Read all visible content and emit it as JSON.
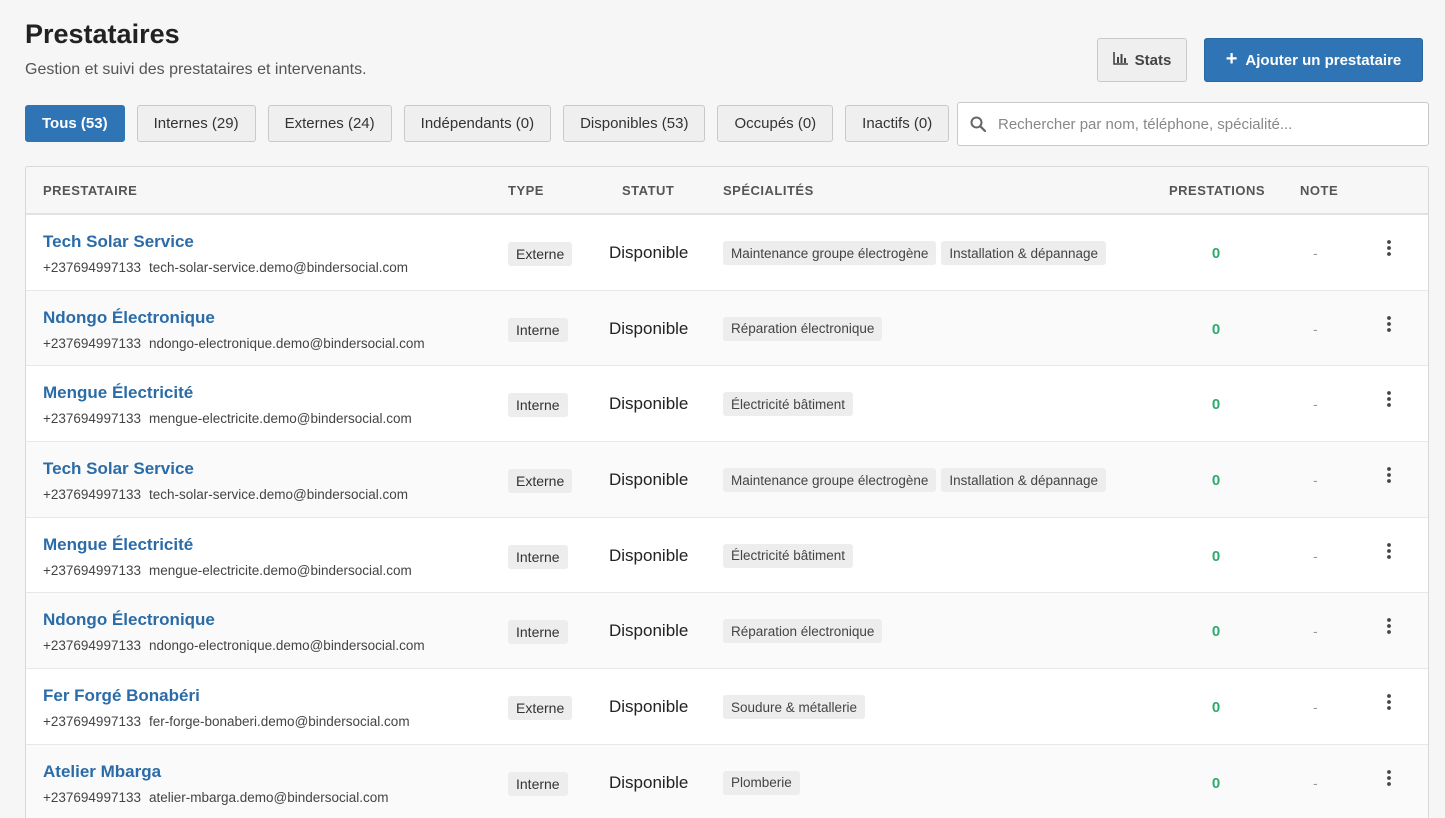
{
  "header": {
    "title": "Prestataires",
    "subtitle": "Gestion et suivi des prestataires et intervenants.",
    "stats_label": "Stats",
    "stats_icon": "bar-chart-icon",
    "add_label": "Ajouter un prestataire",
    "add_icon": "plus-icon"
  },
  "filters": [
    {
      "label": "Tous (53)",
      "active": true
    },
    {
      "label": "Internes (29)",
      "active": false
    },
    {
      "label": "Externes (24)",
      "active": false
    },
    {
      "label": "Indépendants (0)",
      "active": false
    },
    {
      "label": "Disponibles (53)",
      "active": false
    },
    {
      "label": "Occupés (0)",
      "active": false
    },
    {
      "label": "Inactifs (0)",
      "active": false
    }
  ],
  "search": {
    "placeholder": "Rechercher par nom, téléphone, spécialité...",
    "value": "",
    "icon": "search-icon"
  },
  "table": {
    "columns": {
      "prestataire": "PRESTATAIRE",
      "type": "TYPE",
      "statut": "STATUT",
      "specialites": "SPÉCIALITÉS",
      "prestations": "PRESTATIONS",
      "note": "NOTE"
    },
    "rows": [
      {
        "name": "Tech Solar Service",
        "phone": "+237694997133",
        "email": "tech-solar-service.demo@bindersocial.com",
        "type": "Externe",
        "status": "Disponible",
        "specialties": [
          "Maintenance groupe électrogène",
          "Installation & dépannage"
        ],
        "prestations": "0",
        "note": "-"
      },
      {
        "name": "Ndongo Électronique",
        "phone": "+237694997133",
        "email": "ndongo-electronique.demo@bindersocial.com",
        "type": "Interne",
        "status": "Disponible",
        "specialties": [
          "Réparation électronique"
        ],
        "prestations": "0",
        "note": "-"
      },
      {
        "name": "Mengue Électricité",
        "phone": "+237694997133",
        "email": "mengue-electricite.demo@bindersocial.com",
        "type": "Interne",
        "status": "Disponible",
        "specialties": [
          "Électricité bâtiment"
        ],
        "prestations": "0",
        "note": "-"
      },
      {
        "name": "Tech Solar Service",
        "phone": "+237694997133",
        "email": "tech-solar-service.demo@bindersocial.com",
        "type": "Externe",
        "status": "Disponible",
        "specialties": [
          "Maintenance groupe électrogène",
          "Installation & dépannage"
        ],
        "prestations": "0",
        "note": "-"
      },
      {
        "name": "Mengue Électricité",
        "phone": "+237694997133",
        "email": "mengue-electricite.demo@bindersocial.com",
        "type": "Interne",
        "status": "Disponible",
        "specialties": [
          "Électricité bâtiment"
        ],
        "prestations": "0",
        "note": "-"
      },
      {
        "name": "Ndongo Électronique",
        "phone": "+237694997133",
        "email": "ndongo-electronique.demo@bindersocial.com",
        "type": "Interne",
        "status": "Disponible",
        "specialties": [
          "Réparation électronique"
        ],
        "prestations": "0",
        "note": "-"
      },
      {
        "name": "Fer Forgé Bonabéri",
        "phone": "+237694997133",
        "email": "fer-forge-bonaberi.demo@bindersocial.com",
        "type": "Externe",
        "status": "Disponible",
        "specialties": [
          "Soudure & métallerie"
        ],
        "prestations": "0",
        "note": "-"
      },
      {
        "name": "Atelier Mbarga",
        "phone": "+237694997133",
        "email": "atelier-mbarga.demo@bindersocial.com",
        "type": "Interne",
        "status": "Disponible",
        "specialties": [
          "Plomberie"
        ],
        "prestations": "0",
        "note": "-"
      }
    ],
    "row_action_icon": "more-vertical-icon"
  },
  "colors": {
    "accent": "#2f74b5",
    "link": "#2b6ca8",
    "count_green": "#2eaa6f"
  }
}
